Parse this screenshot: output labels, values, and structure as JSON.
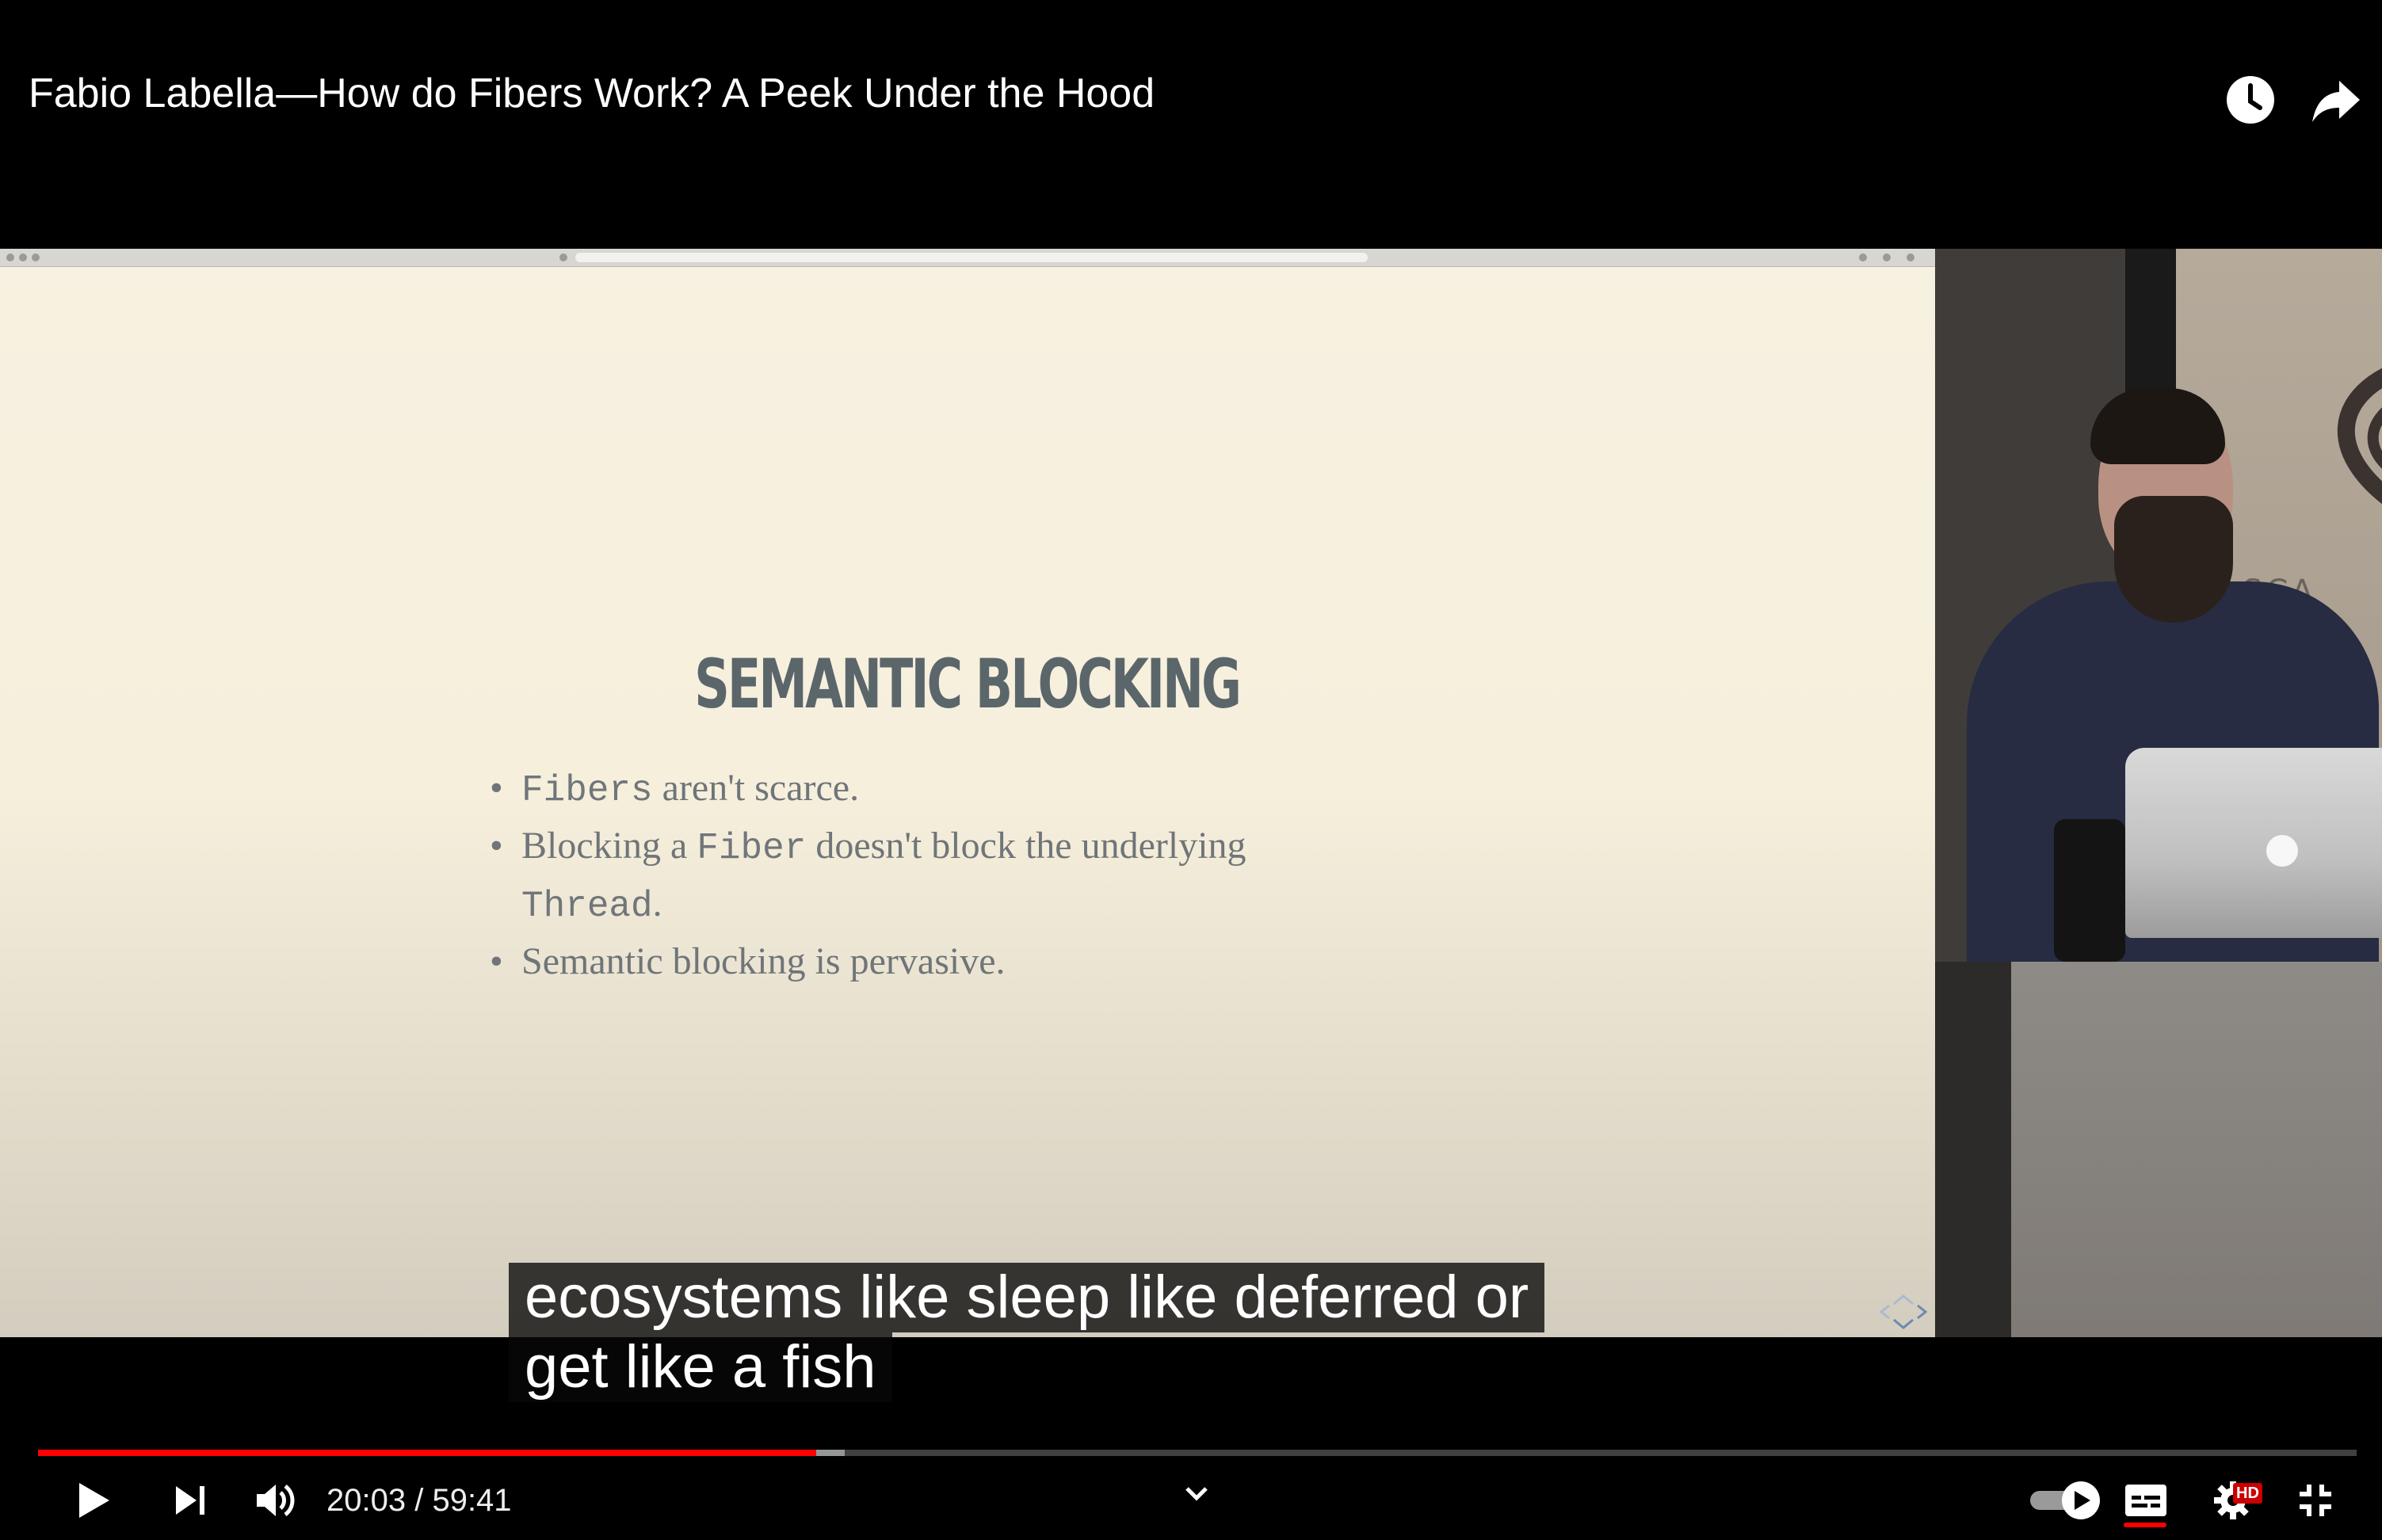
{
  "video": {
    "title": "Fabio Labella—How do Fibers Work? A Peek Under the Hood"
  },
  "slide": {
    "title": "SEMANTIC BLOCKING",
    "bullets": [
      {
        "parts": [
          {
            "text": "Fibers",
            "code": true
          },
          {
            "text": " aren't scarce.",
            "code": false
          }
        ]
      },
      {
        "parts": [
          {
            "text": "Blocking a ",
            "code": false
          },
          {
            "text": "Fiber",
            "code": true
          },
          {
            "text": " doesn't block the underlying",
            "code": false
          }
        ]
      },
      {
        "parts": [
          {
            "text": "Thread",
            "code": true
          },
          {
            "text": ".",
            "code": false
          }
        ],
        "continuation": true
      },
      {
        "parts": [
          {
            "text": "Semantic blocking is pervasive.",
            "code": false
          }
        ]
      }
    ],
    "banner_text": "SCA"
  },
  "caption": {
    "lines": [
      "ecosystems like sleep like deferred or",
      "get like a fish"
    ]
  },
  "player": {
    "current_time": "20:03",
    "duration": "59:41",
    "time_separator": " / ",
    "played_fraction": 0.3355,
    "buffered_fraction": 0.3478,
    "hd_badge": "HD",
    "colors": {
      "progress_played": "#ff0000",
      "hd_badge": "#cc0000"
    },
    "icons": {
      "play": "play-icon",
      "next": "next-icon",
      "volume": "volume-icon",
      "chevron": "chevron-down-icon",
      "autoplay": "autoplay-toggle-icon",
      "captions": "captions-icon",
      "settings": "gear-icon",
      "exit_fullscreen": "exit-fullscreen-icon",
      "watch_later": "clock-icon",
      "share": "share-icon"
    }
  }
}
